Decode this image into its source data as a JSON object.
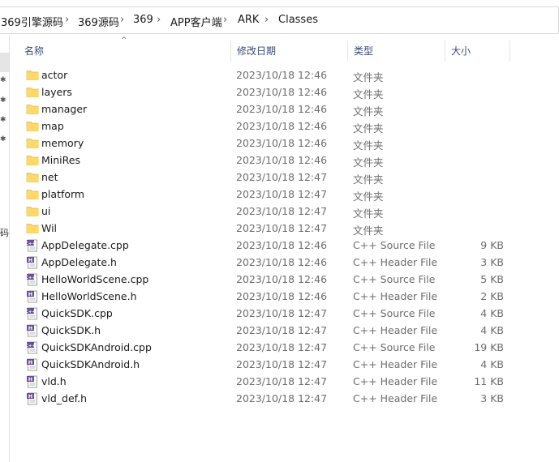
{
  "breadcrumb": [
    "369引擎源码",
    "369源码",
    "369",
    "APP客户端",
    "ARK",
    "Classes"
  ],
  "nav": {
    "partial_char": "码"
  },
  "columns": {
    "name": "名称",
    "modified": "修改日期",
    "type": "类型",
    "size": "大小"
  },
  "files": [
    {
      "name": "actor",
      "date": "2023/10/18 12:46",
      "type": "文件夹",
      "size": "",
      "icon": "folder-icon"
    },
    {
      "name": "layers",
      "date": "2023/10/18 12:46",
      "type": "文件夹",
      "size": "",
      "icon": "folder-icon"
    },
    {
      "name": "manager",
      "date": "2023/10/18 12:46",
      "type": "文件夹",
      "size": "",
      "icon": "folder-icon"
    },
    {
      "name": "map",
      "date": "2023/10/18 12:46",
      "type": "文件夹",
      "size": "",
      "icon": "folder-icon"
    },
    {
      "name": "memory",
      "date": "2023/10/18 12:46",
      "type": "文件夹",
      "size": "",
      "icon": "folder-icon"
    },
    {
      "name": "MiniRes",
      "date": "2023/10/18 12:46",
      "type": "文件夹",
      "size": "",
      "icon": "folder-icon"
    },
    {
      "name": "net",
      "date": "2023/10/18 12:47",
      "type": "文件夹",
      "size": "",
      "icon": "folder-icon"
    },
    {
      "name": "platform",
      "date": "2023/10/18 12:47",
      "type": "文件夹",
      "size": "",
      "icon": "folder-icon"
    },
    {
      "name": "ui",
      "date": "2023/10/18 12:47",
      "type": "文件夹",
      "size": "",
      "icon": "folder-icon"
    },
    {
      "name": "Wil",
      "date": "2023/10/18 12:47",
      "type": "文件夹",
      "size": "",
      "icon": "folder-icon"
    },
    {
      "name": "AppDelegate.cpp",
      "date": "2023/10/18 12:46",
      "type": "C++ Source File",
      "size": "9 KB",
      "icon": "cpp-file-icon"
    },
    {
      "name": "AppDelegate.h",
      "date": "2023/10/18 12:46",
      "type": "C++ Header File",
      "size": "3 KB",
      "icon": "h-file-icon"
    },
    {
      "name": "HelloWorldScene.cpp",
      "date": "2023/10/18 12:46",
      "type": "C++ Source File",
      "size": "5 KB",
      "icon": "cpp-file-icon"
    },
    {
      "name": "HelloWorldScene.h",
      "date": "2023/10/18 12:46",
      "type": "C++ Header File",
      "size": "2 KB",
      "icon": "h-file-icon"
    },
    {
      "name": "QuickSDK.cpp",
      "date": "2023/10/18 12:47",
      "type": "C++ Source File",
      "size": "4 KB",
      "icon": "cpp-file-icon"
    },
    {
      "name": "QuickSDK.h",
      "date": "2023/10/18 12:47",
      "type": "C++ Header File",
      "size": "4 KB",
      "icon": "h-file-icon"
    },
    {
      "name": "QuickSDKAndroid.cpp",
      "date": "2023/10/18 12:47",
      "type": "C++ Source File",
      "size": "19 KB",
      "icon": "cpp-file-icon"
    },
    {
      "name": "QuickSDKAndroid.h",
      "date": "2023/10/18 12:47",
      "type": "C++ Header File",
      "size": "4 KB",
      "icon": "h-file-icon"
    },
    {
      "name": "vld.h",
      "date": "2023/10/18 12:47",
      "type": "C++ Header File",
      "size": "11 KB",
      "icon": "h-file-icon"
    },
    {
      "name": "vld_def.h",
      "date": "2023/10/18 12:47",
      "type": "C++ Header File",
      "size": "3 KB",
      "icon": "h-file-icon"
    }
  ]
}
